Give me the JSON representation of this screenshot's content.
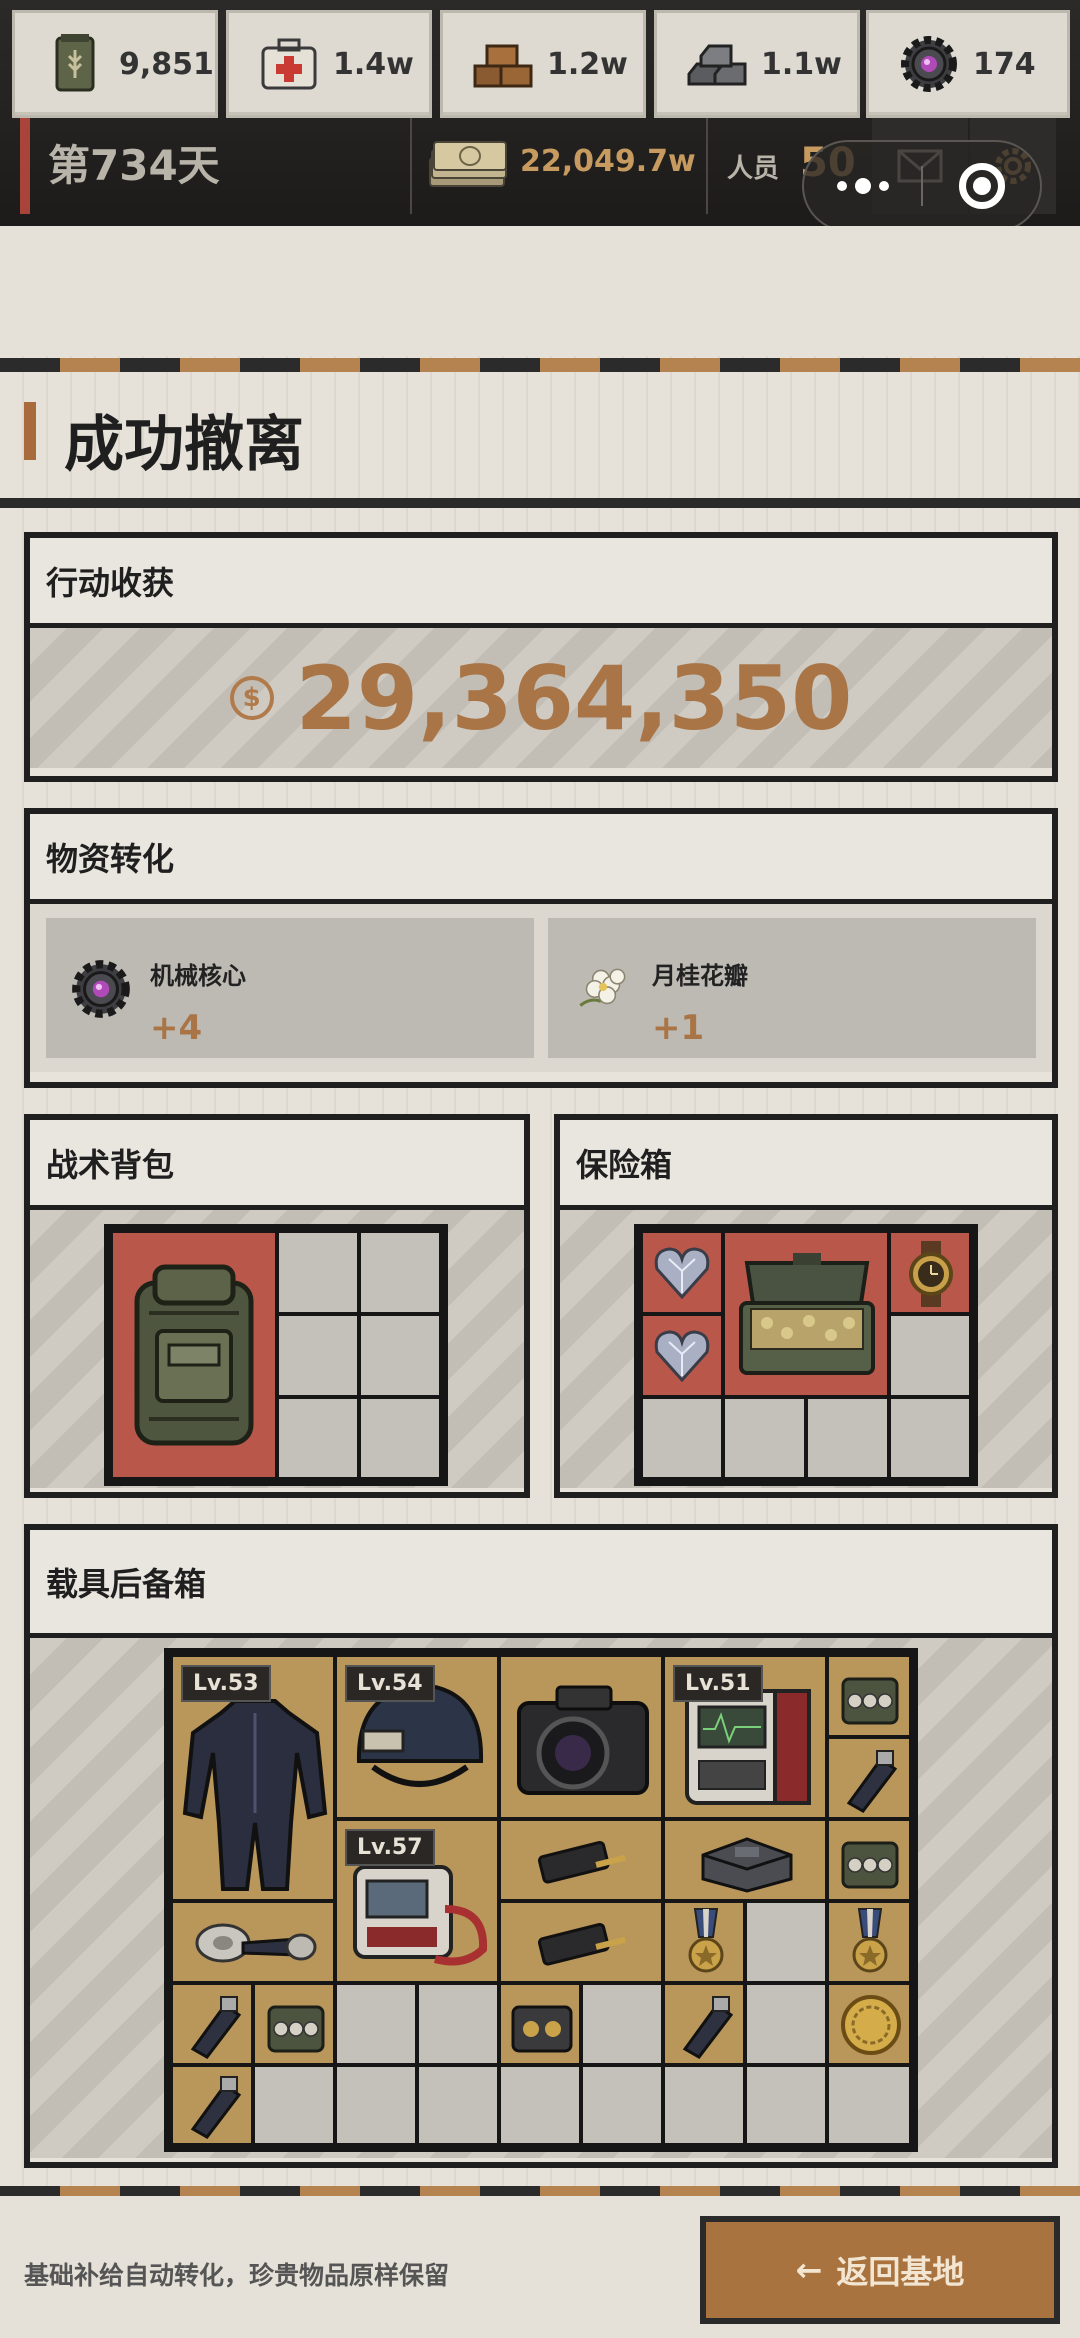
{
  "header": {
    "day_label": "第734天",
    "money": "22,049.7w",
    "staff_label": "人员",
    "staff_count": "50"
  },
  "resources": [
    {
      "icon": "grain-sack-icon",
      "value": "9,851"
    },
    {
      "icon": "medkit-icon",
      "value": "1.4w"
    },
    {
      "icon": "wood-planks-icon",
      "value": "1.2w"
    },
    {
      "icon": "steel-ingots-icon",
      "value": "1.1w"
    },
    {
      "icon": "mech-core-icon",
      "value": "174"
    }
  ],
  "page": {
    "title": "成功撤离"
  },
  "earnings": {
    "title": "行动收获",
    "amount": "29,364,350",
    "currency_icon": "$"
  },
  "conversion": {
    "title": "物资转化",
    "items": [
      {
        "name": "机械核心",
        "qty": "+4",
        "icon": "mech-core-icon"
      },
      {
        "name": "月桂花瓣",
        "qty": "+1",
        "icon": "laurel-flower-icon"
      }
    ]
  },
  "backpack": {
    "title": "战术背包"
  },
  "safebox": {
    "title": "保险箱"
  },
  "trunk": {
    "title": "载具后备箱",
    "levels": [
      "Lv.53",
      "Lv.54",
      "Lv.51",
      "Lv.57"
    ]
  },
  "footer": {
    "note": "基础补给自动转化，珍贵物品原样保留",
    "back_label": "返回基地",
    "back_arrow": "←"
  },
  "colors": {
    "accent": "#a97546",
    "danger": "#b9574b",
    "tan": "#b9965a"
  }
}
